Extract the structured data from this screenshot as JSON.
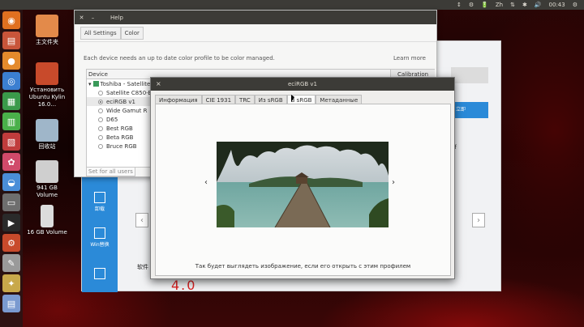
{
  "topbar": {
    "items": [
      "↕",
      "⚙",
      "🔋",
      "Zh",
      "⇅",
      "✱",
      "🔊",
      "00:43",
      "⚙"
    ]
  },
  "desktop": {
    "icons": [
      {
        "label": "主文件夹",
        "color": "#e38a4a"
      },
      {
        "label": "Установить Ubuntu Kylin 16.0…",
        "color": "#c84a2b"
      },
      {
        "label": "回收站",
        "color": "#9fb6c9"
      },
      {
        "label": "941 GB Volume",
        "color": "#cfcfcf"
      },
      {
        "label": "16 GB Volume",
        "color": "#dcdcdc"
      }
    ]
  },
  "bg_app": {
    "side_items": [
      "卸载",
      "Win替换"
    ],
    "blue_btn": "立即",
    "software_label": "软件",
    "version": "4.0",
    "left_arrow": "‹",
    "right_arrow": "›",
    "right_text": "of"
  },
  "settings": {
    "title": "Help",
    "crumbs": [
      "All Settings",
      "Color"
    ],
    "description": "Each device needs an up to date color profile to be color managed.",
    "learn_more": "Learn more",
    "device_header": "Device",
    "calibration": "Calibration",
    "devices": [
      {
        "label": "Toshiba - Satellite C",
        "type": "group"
      },
      {
        "label": "Satellite C850-B",
        "type": "profile",
        "selected": false
      },
      {
        "label": "eciRGB v1",
        "type": "profile",
        "selected": true
      },
      {
        "label": "Wide Gamut R",
        "type": "profile",
        "selected": false
      },
      {
        "label": "D65",
        "type": "profile",
        "selected": false
      },
      {
        "label": "Best RGB",
        "type": "profile",
        "selected": false
      },
      {
        "label": "Beta RGB",
        "type": "profile",
        "selected": false
      },
      {
        "label": "Bruce RGB",
        "type": "profile",
        "selected": false
      }
    ],
    "set_all": "Set for all users"
  },
  "dialog": {
    "title": "eciRGB v1",
    "close": "×",
    "tabs": [
      "Информация",
      "CIE 1931",
      "TRC",
      "Из sRGB",
      "В sRGB",
      "Метаданные"
    ],
    "active_tab": 4,
    "prev": "‹",
    "next": "›",
    "caption": "Так будет выглядеть изображение, если его открыть с этим профилем"
  },
  "colors": {
    "panel": "#3c3b37",
    "accent": "#2b8ad8",
    "wallpaper": "#3a0606"
  }
}
